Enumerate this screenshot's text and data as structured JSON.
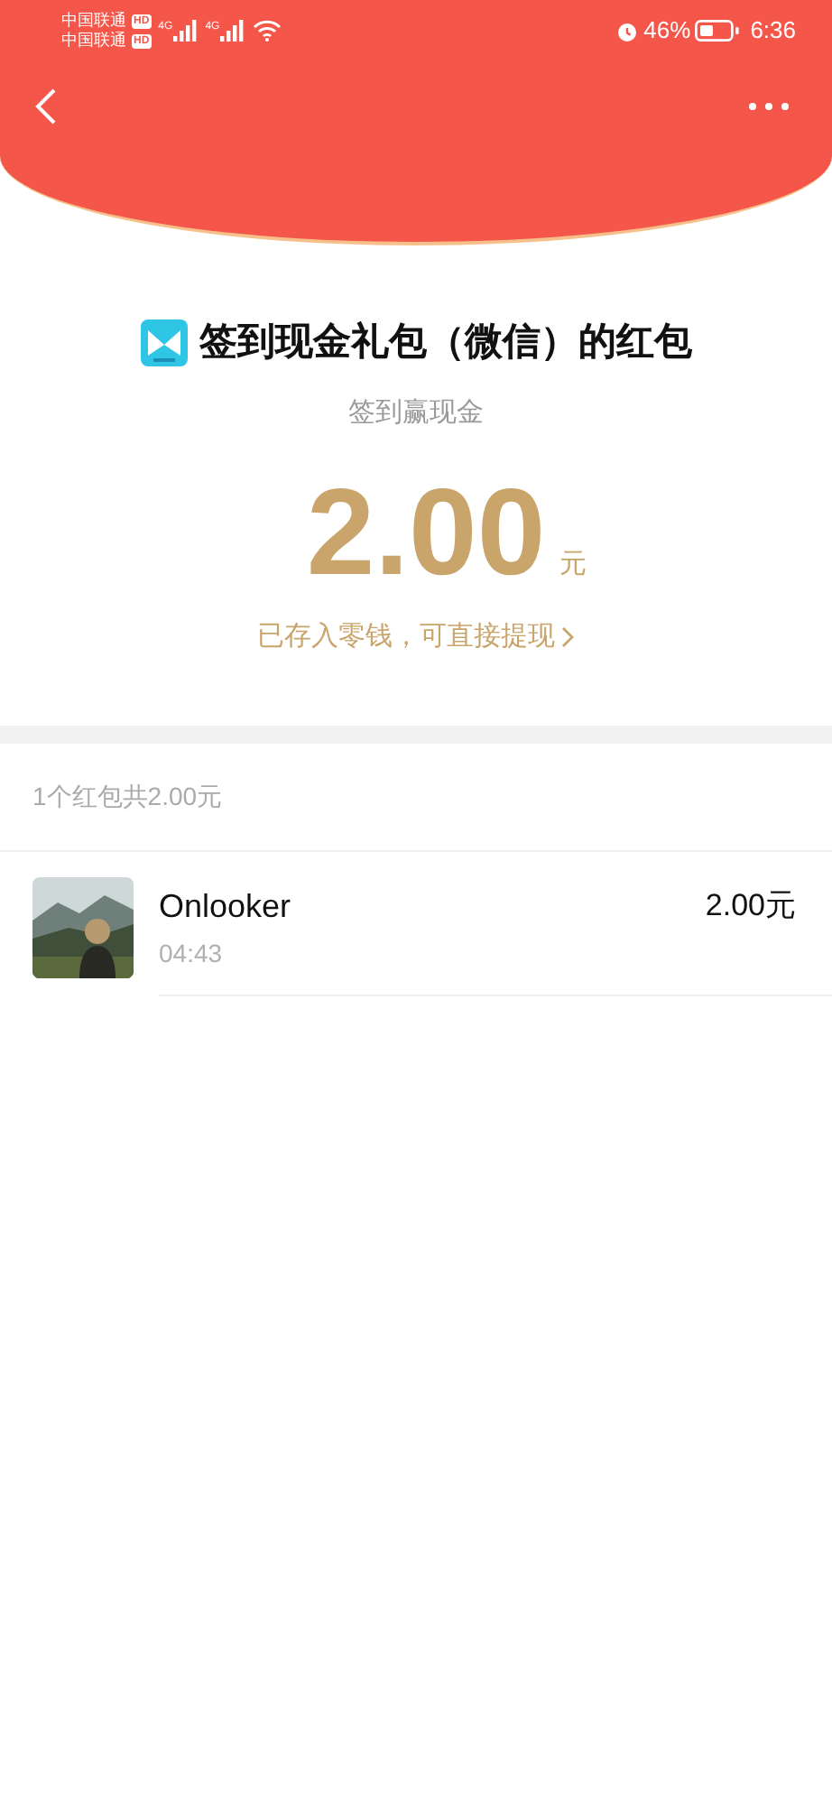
{
  "status_bar": {
    "carriers": [
      {
        "name": "中国联通",
        "badge": "HD"
      },
      {
        "name": "中国联通",
        "badge": "HD"
      }
    ],
    "signals": [
      {
        "network": "4G"
      },
      {
        "network": "4G"
      }
    ],
    "battery_percent": "46%",
    "time": "6:36"
  },
  "envelope": {
    "title": "签到现金礼包（微信）的红包",
    "subtitle": "签到赢现金",
    "amount": "2.00",
    "unit": "元",
    "link": "已存入零钱，可直接提现"
  },
  "summary": "1个红包共2.00元",
  "records": [
    {
      "name": "Onlooker",
      "time": "04:43",
      "amount": "2.00元"
    }
  ]
}
